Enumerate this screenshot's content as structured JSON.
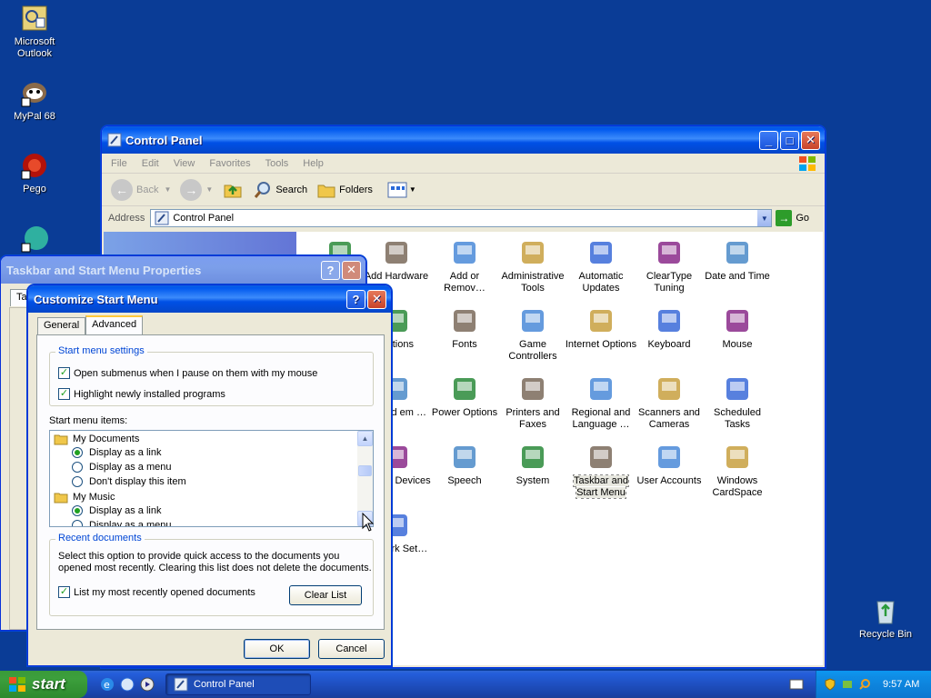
{
  "desktop": {
    "icons": [
      {
        "label": "Microsoft Outlook"
      },
      {
        "label": "MyPal 68"
      },
      {
        "label": "Pego"
      },
      {
        "label": ""
      },
      {
        "label": "Recycle Bin"
      }
    ]
  },
  "control_panel": {
    "title": "Control Panel",
    "menu": [
      "File",
      "Edit",
      "View",
      "Favorites",
      "Tools",
      "Help"
    ],
    "toolbar": {
      "back": "Back",
      "search": "Search",
      "folders": "Folders"
    },
    "address_label": "Address",
    "address_value": "Control Panel",
    "go": "Go",
    "items": [
      {
        "label": "",
        "icon": "accessibility-icon"
      },
      {
        "label": "Add Hardware",
        "icon": "add-hardware-icon"
      },
      {
        "label": "Add or Remov…",
        "icon": "add-remove-programs-icon"
      },
      {
        "label": "Administrative Tools",
        "icon": "administrative-tools-icon"
      },
      {
        "label": "Automatic Updates",
        "icon": "automatic-updates-icon"
      },
      {
        "label": "ClearType Tuning",
        "icon": "cleartype-icon"
      },
      {
        "label": "Date and Time",
        "icon": "date-time-icon"
      },
      {
        "label": "Options",
        "icon": "options-icon"
      },
      {
        "label": "Fonts",
        "icon": "fonts-icon"
      },
      {
        "label": "Game Controllers",
        "icon": "game-controllers-icon"
      },
      {
        "label": "Internet Options",
        "icon": "internet-options-icon"
      },
      {
        "label": "Keyboard",
        "icon": "keyboard-icon"
      },
      {
        "label": "Mouse",
        "icon": "mouse-icon"
      },
      {
        "label": "ne and em …",
        "icon": "network-icon"
      },
      {
        "label": "Power Options",
        "icon": "power-options-icon"
      },
      {
        "label": "Printers and Faxes",
        "icon": "printers-icon"
      },
      {
        "label": "Regional and Language …",
        "icon": "regional-icon"
      },
      {
        "label": "Scanners and Cameras",
        "icon": "scanners-icon"
      },
      {
        "label": "Scheduled Tasks",
        "icon": "scheduled-tasks-icon"
      },
      {
        "label": "ds and Devices",
        "icon": "sounds-icon"
      },
      {
        "label": "Speech",
        "icon": "speech-icon"
      },
      {
        "label": "System",
        "icon": "system-icon"
      },
      {
        "label": "Taskbar and Start Menu",
        "icon": "taskbar-icon"
      },
      {
        "label": "User Accounts",
        "icon": "user-accounts-icon"
      },
      {
        "label": "Windows CardSpace",
        "icon": "cardspace-icon"
      },
      {
        "label": "eless rk Set…",
        "icon": "wireless-icon"
      }
    ]
  },
  "taskbar_props": {
    "title": "Taskbar and Start Menu Properties",
    "tab_partial": "Ta"
  },
  "customize": {
    "title": "Customize Start Menu",
    "tabs": [
      "General",
      "Advanced"
    ],
    "settings_group": "Start menu settings",
    "opt1": "Open submenus when I pause on them with my mouse",
    "opt2": "Highlight newly installed programs",
    "items_label": "Start menu items:",
    "list": [
      {
        "text": "My Documents",
        "type": "folder"
      },
      {
        "text": "Display as a link",
        "type": "radio",
        "selected": true
      },
      {
        "text": "Display as a menu",
        "type": "radio",
        "selected": false
      },
      {
        "text": "Don't display this item",
        "type": "radio",
        "selected": false
      },
      {
        "text": "My Music",
        "type": "folder"
      },
      {
        "text": "Display as a link",
        "type": "radio",
        "selected": true
      },
      {
        "text": "Display as a menu",
        "type": "radio",
        "selected": false
      }
    ],
    "recent_group": "Recent documents",
    "recent_desc1": "Select this option to provide quick access to the documents you",
    "recent_desc2": "opened most recently.  Clearing this list does not delete the documents.",
    "recent_check": "List my most recently opened documents",
    "clear_list": "Clear List",
    "ok": "OK",
    "cancel": "Cancel"
  },
  "taskbar": {
    "start": "start",
    "task": "Control Panel",
    "time": "9:57 AM"
  },
  "colors": {
    "desktop": "#0a3c96",
    "titlebar": "#0058ee",
    "start_green": "#3c9f3c",
    "tray": "#0f8de6"
  }
}
